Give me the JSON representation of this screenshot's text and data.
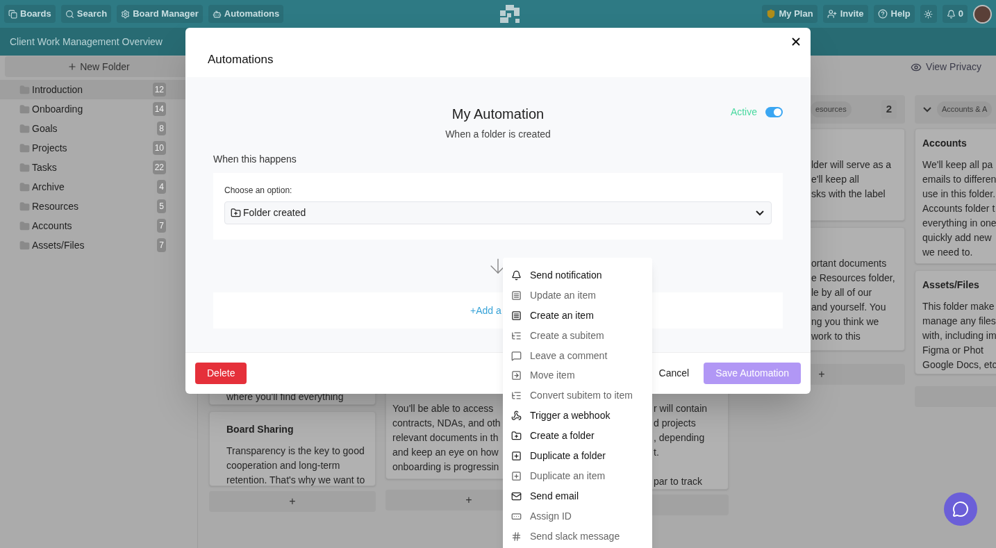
{
  "top_bar": {
    "nav": [
      {
        "label": "Boards"
      },
      {
        "label": "Search"
      },
      {
        "label": "Board Manager"
      },
      {
        "label": "Automations"
      }
    ],
    "actions": [
      {
        "label": "My Plan"
      },
      {
        "label": "Invite"
      },
      {
        "label": "Help"
      }
    ],
    "notifications": "0"
  },
  "board_title": "Client Work Management Overview",
  "sidebar": {
    "new_folder": "New Folder",
    "folders": [
      {
        "name": "Introduction",
        "count": "12",
        "selected": true
      },
      {
        "name": "Onboarding",
        "count": "14",
        "selected": false
      },
      {
        "name": "Goals",
        "count": "8",
        "selected": false
      },
      {
        "name": "Projects",
        "count": "10",
        "selected": false
      },
      {
        "name": "Tasks",
        "count": "22",
        "selected": false
      },
      {
        "name": "Archive",
        "count": "4",
        "selected": false
      },
      {
        "name": "Resources",
        "count": "5",
        "selected": false
      },
      {
        "name": "Accounts",
        "count": "7",
        "selected": false
      },
      {
        "name": "Assets/Files",
        "count": "7",
        "selected": false
      }
    ]
  },
  "board": {
    "view_privacy": "View Privacy",
    "columns": [
      {
        "cards": [
          {
            "paragraphs": [
              [
                "where you'll find everything"
              ]
            ]
          },
          {
            "title": "Board Sharing",
            "paragraphs": [
              [
                "Transparency is the key to good",
                "cooperation and long-term",
                "retention. That's why we want to"
              ]
            ]
          }
        ],
        "add": "+"
      },
      {
        "cards": [
          {
            "paragraphs": [
              [
                "You'll be able to access",
                "contracts, NDAs, and oth",
                "relevant documents in th",
                "and keep an eye on how",
                "onboarding is progressin"
              ]
            ]
          }
        ],
        "add": "+"
      },
      {
        "cards": [
          {
            "paragraphs": [
              [
                "r will contain",
                "d projects",
                ", depending",
                "t."
              ],
              [
                "par to track"
              ]
            ]
          }
        ]
      },
      {
        "header": {
          "tag": "esources",
          "count": "2"
        },
        "cards": [
          {
            "paragraphs": [
              [
                "lder will serve as a",
                "e'll keep all",
                "sks with the label"
              ]
            ]
          },
          {
            "paragraphs": [
              [
                "ortant documents",
                "e Resources folder,",
                "le by all of our",
                "and yourself. You",
                "ng you think we",
                "work to this"
              ]
            ]
          }
        ],
        "add": "+"
      },
      {
        "header": {
          "tag": "Accounts & A",
          "collapsible": true
        },
        "cards": [
          {
            "title": "Accounts",
            "paragraphs": [
              [
                "We'll keep all pa",
                "emails to differen",
                "use in this folder.",
                "Accounts folder t",
                "everything in one",
                "quickly add new",
                "we need to."
              ]
            ]
          },
          {
            "title": "Assets/Files",
            "paragraphs": [
              [
                "This folder make",
                "manage any files",
                "with, including im",
                "Figma or Phot",
                "Google Docs, etc"
              ]
            ]
          }
        ]
      }
    ]
  },
  "modal": {
    "title": "Automations",
    "name": "My Automation",
    "status": "Active",
    "active": true,
    "summary": "When a folder is created",
    "trigger_label": "When this happens",
    "choose_label": "Choose an option:",
    "choice": "Folder created",
    "add_action": "+Add a",
    "buttons": {
      "delete": "Delete",
      "cancel": "Cancel",
      "save": "Save Automation"
    }
  },
  "menu": {
    "items": [
      {
        "label": "Send notification",
        "disabled": false
      },
      {
        "label": "Update an item",
        "disabled": true
      },
      {
        "label": "Create an item",
        "disabled": false
      },
      {
        "label": "Create a subitem",
        "disabled": true
      },
      {
        "label": "Leave a comment",
        "disabled": true
      },
      {
        "label": "Move item",
        "disabled": true
      },
      {
        "label": "Convert subitem to item",
        "disabled": true
      },
      {
        "label": "Trigger a webhook",
        "disabled": false
      },
      {
        "label": "Create a folder",
        "disabled": false
      },
      {
        "label": "Duplicate a folder",
        "disabled": false
      },
      {
        "label": "Duplicate an item",
        "disabled": true
      },
      {
        "label": "Send email",
        "disabled": false
      },
      {
        "label": "Assign ID",
        "disabled": true
      },
      {
        "label": "Send slack message",
        "disabled": true
      }
    ]
  }
}
